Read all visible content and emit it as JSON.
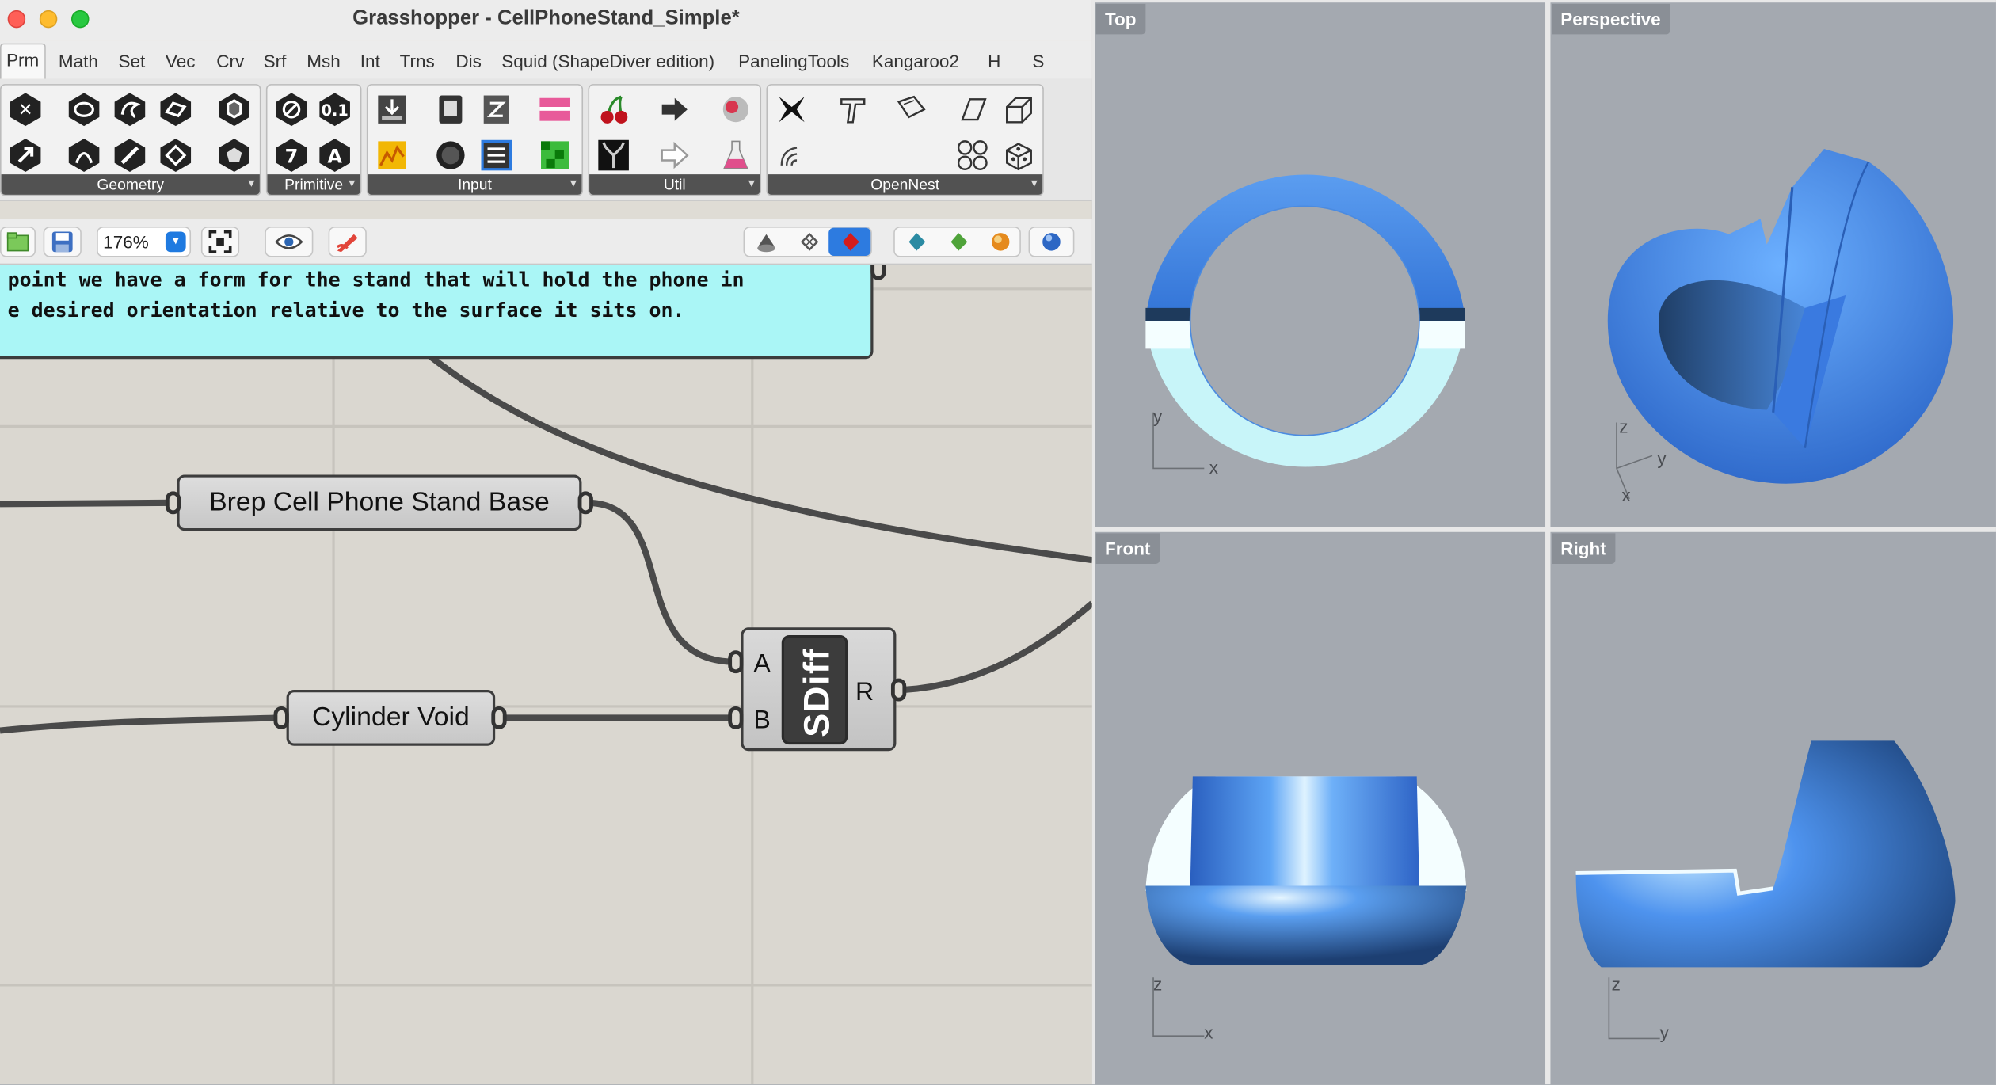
{
  "window": {
    "title": "Grasshopper - CellPhoneStand_Simple*"
  },
  "menu_tabs": [
    "Prm",
    "Math",
    "Set",
    "Vec",
    "Crv",
    "Srf",
    "Msh",
    "Int",
    "Trns",
    "Dis",
    "Squid (ShapeDiver edition)",
    "PanelingTools",
    "Kangaroo2",
    "H",
    "S"
  ],
  "ribbon": {
    "panels": [
      "Geometry",
      "Primitive",
      "Input",
      "Util",
      "OpenNest"
    ]
  },
  "toolbar": {
    "zoom": "176%"
  },
  "canvas": {
    "note_lines": [
      "point we have a form for the stand that will hold the phone in",
      "e desired orientation relative to the surface it sits on."
    ],
    "params": {
      "brep": "Brep Cell Phone Stand Base",
      "cylinder": "Cylinder Void"
    },
    "component": {
      "name": "SDiff",
      "inputs": [
        "A",
        "B"
      ],
      "output": "R"
    }
  },
  "viewports": [
    {
      "label": "Top",
      "axes": [
        "x",
        "y"
      ]
    },
    {
      "label": "Perspective",
      "axes": [
        "x",
        "y",
        "z"
      ]
    },
    {
      "label": "Front",
      "axes": [
        "x",
        "z"
      ]
    },
    {
      "label": "Right",
      "axes": [
        "y",
        "z"
      ]
    }
  ],
  "colors": {
    "object_blue": "#4a8fe8",
    "note_cyan": "#aaf6f6",
    "canvas": "#dad7d0",
    "viewport_bg": "#a4a9b0"
  }
}
